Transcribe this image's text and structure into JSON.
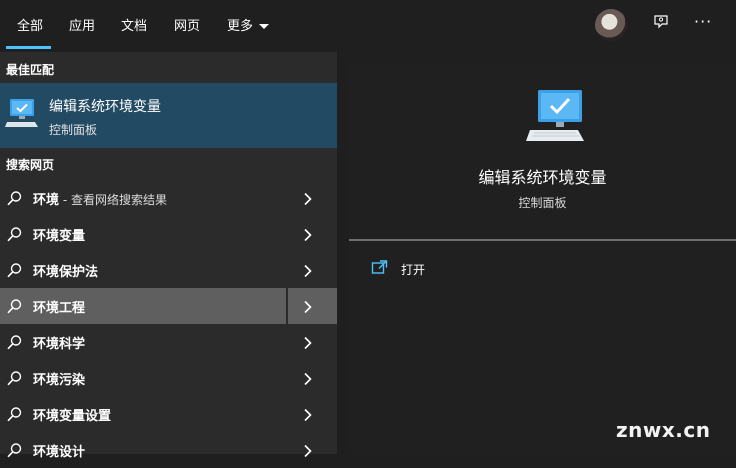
{
  "tabs": [
    "全部",
    "应用",
    "文档",
    "网页",
    "更多"
  ],
  "sections": {
    "best_match": "最佳匹配",
    "search_web": "搜索网页"
  },
  "best_match": {
    "title": "编辑系统环境变量",
    "subtitle": "控制面板"
  },
  "results": [
    {
      "label": "环境",
      "suffix": " - 查看网络搜索结果"
    },
    {
      "label": "环境变量"
    },
    {
      "label": "环境保护法"
    },
    {
      "label": "环境工程"
    },
    {
      "label": "环境科学"
    },
    {
      "label": "环境污染"
    },
    {
      "label": "环境变量设置"
    },
    {
      "label": "环境设计"
    }
  ],
  "highlighted_result_index": 3,
  "detail": {
    "title": "编辑系统环境变量",
    "subtitle": "控制面板",
    "action_open": "打开"
  },
  "more_glyph": "···",
  "watermark": "znwx.cn",
  "colors": {
    "accent": "#4cc2ff",
    "selected": "#234a63",
    "hover": "#5f5f5f"
  },
  "icons": [
    "system-settings-icon",
    "search-icon",
    "chevron-right-icon",
    "feedback-icon",
    "more-icon",
    "open-icon",
    "chevron-down-icon"
  ]
}
